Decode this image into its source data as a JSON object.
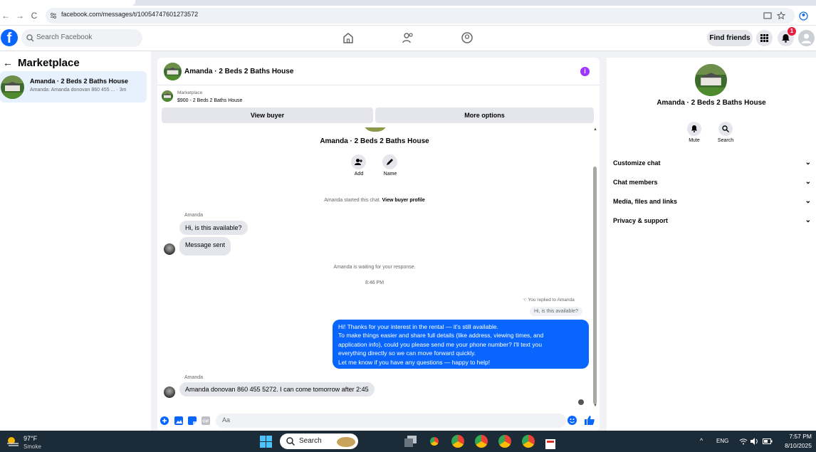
{
  "browser": {
    "url": "facebook.com/messages/t/10054747601273572"
  },
  "header": {
    "logo": "f",
    "search_placeholder": "Search Facebook",
    "find_friends": "Find friends",
    "notification_count": "1"
  },
  "sidebar": {
    "title": "Marketplace",
    "conversations": [
      {
        "name": "Amanda · 2 Beds 2 Baths House",
        "preview": "Amanda: Amanda donovan 860 455 ...  · 3m"
      }
    ]
  },
  "chat": {
    "title": "Amanda · 2 Beds 2 Baths House",
    "listing_label": "Marketplace",
    "listing_price": "$900 - 2 Beds 2 Baths House",
    "view_buyer": "View buyer",
    "more_options": "More options",
    "profile_name": "Amanda · 2 Beds 2 Baths House",
    "add_label": "Add",
    "name_label": "Name",
    "started_text": "Amanda started this chat.",
    "view_buyer_profile": "View buyer profile",
    "messages": [
      {
        "sender": "Amanda",
        "text": "Hi, is this available?"
      },
      {
        "text": "Message sent"
      }
    ],
    "waiting_text": "Amanda is waiting for your response.",
    "time": "8:46 PM",
    "replied_to": "You replied to Amanda",
    "quoted": "Hi, is this available?",
    "reply_lines": [
      "Hi! Thanks for your interest in the rental — it's still available.",
      "To make things easier and share full details (like address, viewing times, and",
      "application info), could you please send me your phone number? I'll text you",
      "everything directly so we can move forward quickly.",
      "Let me know if you have any questions — happy to help!"
    ],
    "last_sender": "Amanda",
    "last_message": "Amanda donovan 860 455 5272. I can come tomorrow after 2:45",
    "composer_placeholder": "Aa"
  },
  "details": {
    "name": "Amanda · 2 Beds 2 Baths House",
    "mute": "Mute",
    "search": "Search",
    "sections": [
      "Customize chat",
      "Chat members",
      "Media, files and links",
      "Privacy & support"
    ]
  },
  "taskbar": {
    "temp": "97°F",
    "weather": "Smoke",
    "search": "Search",
    "lang": "ENG",
    "time": "7:57 PM",
    "date": "8/10/2025"
  }
}
